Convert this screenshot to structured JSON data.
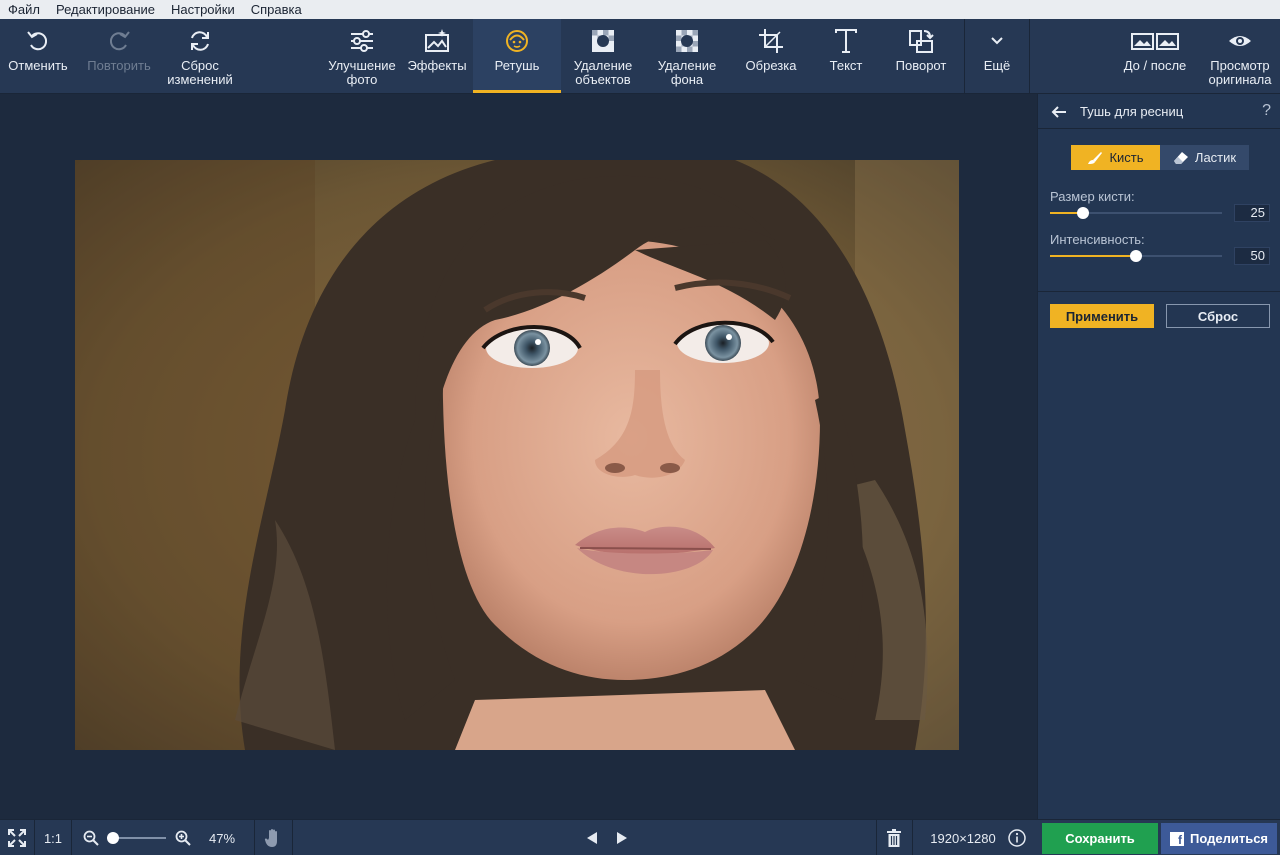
{
  "menu": [
    "Файл",
    "Редактирование",
    "Настройки",
    "Справка"
  ],
  "toolbar": {
    "undo": "Отменить",
    "redo": "Повторить",
    "reset": "Сброс\nизменений",
    "enhance": "Улучшение\nфото",
    "effects": "Эффекты",
    "retouch": "Ретушь",
    "remove_objects": "Удаление\nобъектов",
    "remove_bg": "Удаление\nфона",
    "crop": "Обрезка",
    "text": "Текст",
    "rotate": "Поворот",
    "more": "Ещё",
    "before_after": "До / после",
    "view_original": "Просмотр\nоригинала",
    "active_tab": "Ретушь"
  },
  "panel": {
    "title": "Тушь для ресниц",
    "help": "?",
    "brush_label": "Кисть",
    "eraser_label": "Ластик",
    "brush_size_label": "Размер кисти:",
    "brush_size_value": "25",
    "intensity_label": "Интенсивность:",
    "intensity_value": "50",
    "apply_label": "Применить",
    "reset_label": "Сброс"
  },
  "statusbar": {
    "one_to_one": "1:1",
    "zoom_percent": "47%",
    "zoom_level": 0.1,
    "image_size": "1920×1280",
    "save_label": "Сохранить",
    "share_label": "Поделиться",
    "share_icon_letter": "f"
  },
  "sliders": {
    "brush_size_fraction": 0.19,
    "intensity_fraction": 0.5
  },
  "colors": {
    "accent": "#f0b323",
    "save": "#20a050",
    "share": "#3d5a98",
    "toolbar": "#263854",
    "canvas": "#1d2a3e"
  },
  "icons": [
    "undo-icon",
    "redo-icon",
    "refresh-icon",
    "sliders-icon",
    "effects-icon",
    "face-icon",
    "remove-object-icon",
    "remove-bg-icon",
    "crop-icon",
    "text-icon",
    "rotate-icon",
    "chevron-down-icon",
    "before-after-icon",
    "eye-icon",
    "arrow-left-icon",
    "brush-icon",
    "eraser-icon",
    "fullscreen-icon",
    "zoom-out-icon",
    "zoom-in-icon",
    "hand-icon",
    "prev-icon",
    "next-icon",
    "trash-icon",
    "info-icon"
  ]
}
